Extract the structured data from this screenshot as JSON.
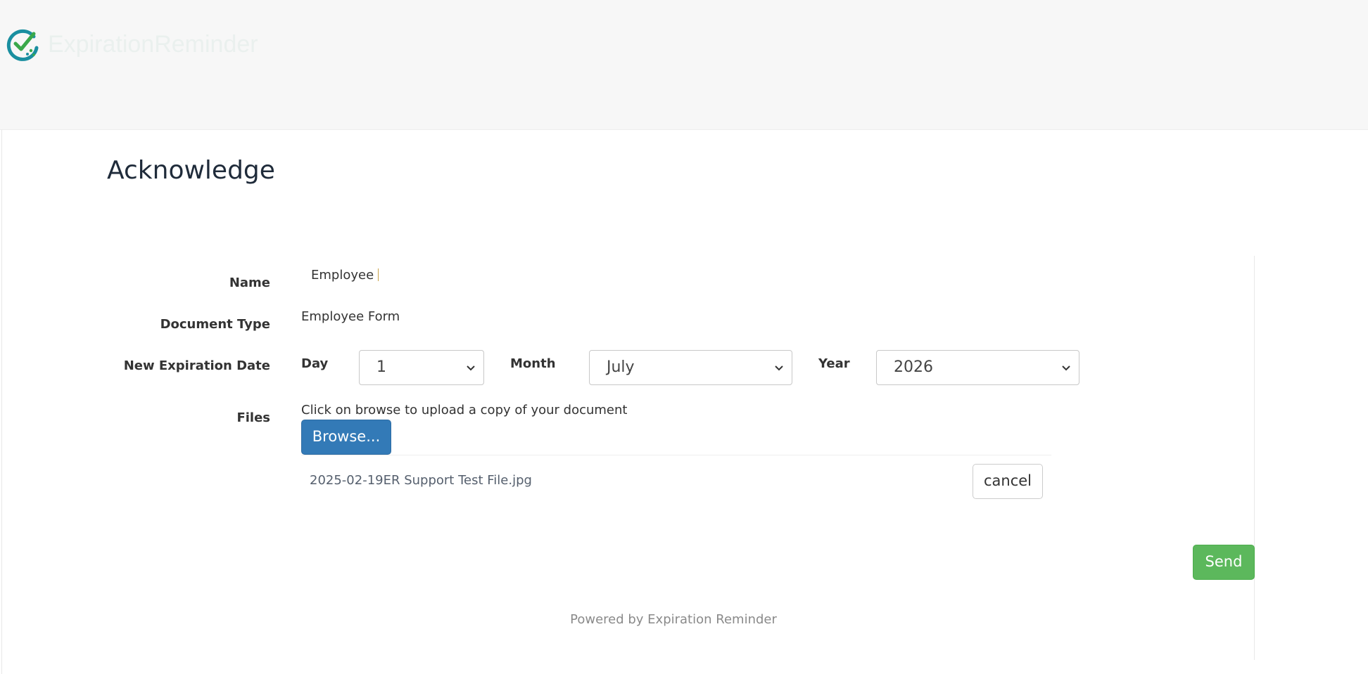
{
  "app": {
    "logo_text": "ExpirationReminder"
  },
  "page": {
    "title": "Acknowledge"
  },
  "form": {
    "name": {
      "label": "Name",
      "value": "Employee"
    },
    "document_type": {
      "label": "Document Type",
      "value": "Employee Form"
    },
    "expiration_date": {
      "label": "New Expiration Date",
      "day_label": "Day",
      "day_value": "1",
      "month_label": "Month",
      "month_value": "July",
      "year_label": "Year",
      "year_value": "2026"
    },
    "files": {
      "label": "Files",
      "hint": "Click on browse to upload a copy of your document",
      "browse_label": "Browse...",
      "file_name": "2025-02-19ER Support Test File.jpg",
      "cancel_label": "cancel"
    },
    "send_label": "Send"
  },
  "footer": {
    "text": "Powered by Expiration Reminder"
  },
  "colors": {
    "header_bg": "#f7f7f7",
    "primary": "#337ab7",
    "success": "#5cb85c",
    "logo_green": "#3aa84a",
    "logo_teal": "#1a8fa0"
  },
  "icons": {
    "logo": "check-clock-logo-icon",
    "select_arrow": "chevron-down-icon"
  }
}
